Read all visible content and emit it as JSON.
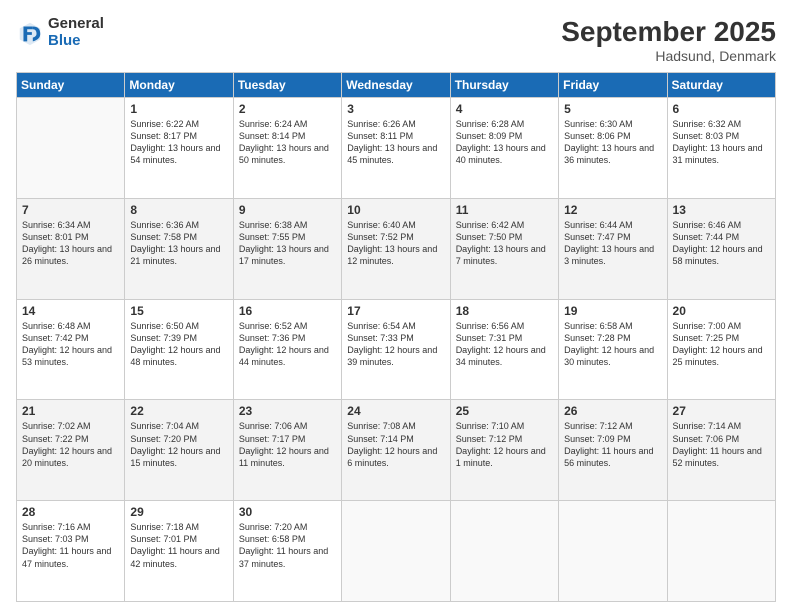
{
  "logo": {
    "general": "General",
    "blue": "Blue"
  },
  "header": {
    "month": "September 2025",
    "location": "Hadsund, Denmark"
  },
  "weekdays": [
    "Sunday",
    "Monday",
    "Tuesday",
    "Wednesday",
    "Thursday",
    "Friday",
    "Saturday"
  ],
  "weeks": [
    [
      {
        "day": "",
        "sunrise": "",
        "sunset": "",
        "daylight": ""
      },
      {
        "day": "1",
        "sunrise": "Sunrise: 6:22 AM",
        "sunset": "Sunset: 8:17 PM",
        "daylight": "Daylight: 13 hours and 54 minutes."
      },
      {
        "day": "2",
        "sunrise": "Sunrise: 6:24 AM",
        "sunset": "Sunset: 8:14 PM",
        "daylight": "Daylight: 13 hours and 50 minutes."
      },
      {
        "day": "3",
        "sunrise": "Sunrise: 6:26 AM",
        "sunset": "Sunset: 8:11 PM",
        "daylight": "Daylight: 13 hours and 45 minutes."
      },
      {
        "day": "4",
        "sunrise": "Sunrise: 6:28 AM",
        "sunset": "Sunset: 8:09 PM",
        "daylight": "Daylight: 13 hours and 40 minutes."
      },
      {
        "day": "5",
        "sunrise": "Sunrise: 6:30 AM",
        "sunset": "Sunset: 8:06 PM",
        "daylight": "Daylight: 13 hours and 36 minutes."
      },
      {
        "day": "6",
        "sunrise": "Sunrise: 6:32 AM",
        "sunset": "Sunset: 8:03 PM",
        "daylight": "Daylight: 13 hours and 31 minutes."
      }
    ],
    [
      {
        "day": "7",
        "sunrise": "Sunrise: 6:34 AM",
        "sunset": "Sunset: 8:01 PM",
        "daylight": "Daylight: 13 hours and 26 minutes."
      },
      {
        "day": "8",
        "sunrise": "Sunrise: 6:36 AM",
        "sunset": "Sunset: 7:58 PM",
        "daylight": "Daylight: 13 hours and 21 minutes."
      },
      {
        "day": "9",
        "sunrise": "Sunrise: 6:38 AM",
        "sunset": "Sunset: 7:55 PM",
        "daylight": "Daylight: 13 hours and 17 minutes."
      },
      {
        "day": "10",
        "sunrise": "Sunrise: 6:40 AM",
        "sunset": "Sunset: 7:52 PM",
        "daylight": "Daylight: 13 hours and 12 minutes."
      },
      {
        "day": "11",
        "sunrise": "Sunrise: 6:42 AM",
        "sunset": "Sunset: 7:50 PM",
        "daylight": "Daylight: 13 hours and 7 minutes."
      },
      {
        "day": "12",
        "sunrise": "Sunrise: 6:44 AM",
        "sunset": "Sunset: 7:47 PM",
        "daylight": "Daylight: 13 hours and 3 minutes."
      },
      {
        "day": "13",
        "sunrise": "Sunrise: 6:46 AM",
        "sunset": "Sunset: 7:44 PM",
        "daylight": "Daylight: 12 hours and 58 minutes."
      }
    ],
    [
      {
        "day": "14",
        "sunrise": "Sunrise: 6:48 AM",
        "sunset": "Sunset: 7:42 PM",
        "daylight": "Daylight: 12 hours and 53 minutes."
      },
      {
        "day": "15",
        "sunrise": "Sunrise: 6:50 AM",
        "sunset": "Sunset: 7:39 PM",
        "daylight": "Daylight: 12 hours and 48 minutes."
      },
      {
        "day": "16",
        "sunrise": "Sunrise: 6:52 AM",
        "sunset": "Sunset: 7:36 PM",
        "daylight": "Daylight: 12 hours and 44 minutes."
      },
      {
        "day": "17",
        "sunrise": "Sunrise: 6:54 AM",
        "sunset": "Sunset: 7:33 PM",
        "daylight": "Daylight: 12 hours and 39 minutes."
      },
      {
        "day": "18",
        "sunrise": "Sunrise: 6:56 AM",
        "sunset": "Sunset: 7:31 PM",
        "daylight": "Daylight: 12 hours and 34 minutes."
      },
      {
        "day": "19",
        "sunrise": "Sunrise: 6:58 AM",
        "sunset": "Sunset: 7:28 PM",
        "daylight": "Daylight: 12 hours and 30 minutes."
      },
      {
        "day": "20",
        "sunrise": "Sunrise: 7:00 AM",
        "sunset": "Sunset: 7:25 PM",
        "daylight": "Daylight: 12 hours and 25 minutes."
      }
    ],
    [
      {
        "day": "21",
        "sunrise": "Sunrise: 7:02 AM",
        "sunset": "Sunset: 7:22 PM",
        "daylight": "Daylight: 12 hours and 20 minutes."
      },
      {
        "day": "22",
        "sunrise": "Sunrise: 7:04 AM",
        "sunset": "Sunset: 7:20 PM",
        "daylight": "Daylight: 12 hours and 15 minutes."
      },
      {
        "day": "23",
        "sunrise": "Sunrise: 7:06 AM",
        "sunset": "Sunset: 7:17 PM",
        "daylight": "Daylight: 12 hours and 11 minutes."
      },
      {
        "day": "24",
        "sunrise": "Sunrise: 7:08 AM",
        "sunset": "Sunset: 7:14 PM",
        "daylight": "Daylight: 12 hours and 6 minutes."
      },
      {
        "day": "25",
        "sunrise": "Sunrise: 7:10 AM",
        "sunset": "Sunset: 7:12 PM",
        "daylight": "Daylight: 12 hours and 1 minute."
      },
      {
        "day": "26",
        "sunrise": "Sunrise: 7:12 AM",
        "sunset": "Sunset: 7:09 PM",
        "daylight": "Daylight: 11 hours and 56 minutes."
      },
      {
        "day": "27",
        "sunrise": "Sunrise: 7:14 AM",
        "sunset": "Sunset: 7:06 PM",
        "daylight": "Daylight: 11 hours and 52 minutes."
      }
    ],
    [
      {
        "day": "28",
        "sunrise": "Sunrise: 7:16 AM",
        "sunset": "Sunset: 7:03 PM",
        "daylight": "Daylight: 11 hours and 47 minutes."
      },
      {
        "day": "29",
        "sunrise": "Sunrise: 7:18 AM",
        "sunset": "Sunset: 7:01 PM",
        "daylight": "Daylight: 11 hours and 42 minutes."
      },
      {
        "day": "30",
        "sunrise": "Sunrise: 7:20 AM",
        "sunset": "Sunset: 6:58 PM",
        "daylight": "Daylight: 11 hours and 37 minutes."
      },
      {
        "day": "",
        "sunrise": "",
        "sunset": "",
        "daylight": ""
      },
      {
        "day": "",
        "sunrise": "",
        "sunset": "",
        "daylight": ""
      },
      {
        "day": "",
        "sunrise": "",
        "sunset": "",
        "daylight": ""
      },
      {
        "day": "",
        "sunrise": "",
        "sunset": "",
        "daylight": ""
      }
    ]
  ]
}
